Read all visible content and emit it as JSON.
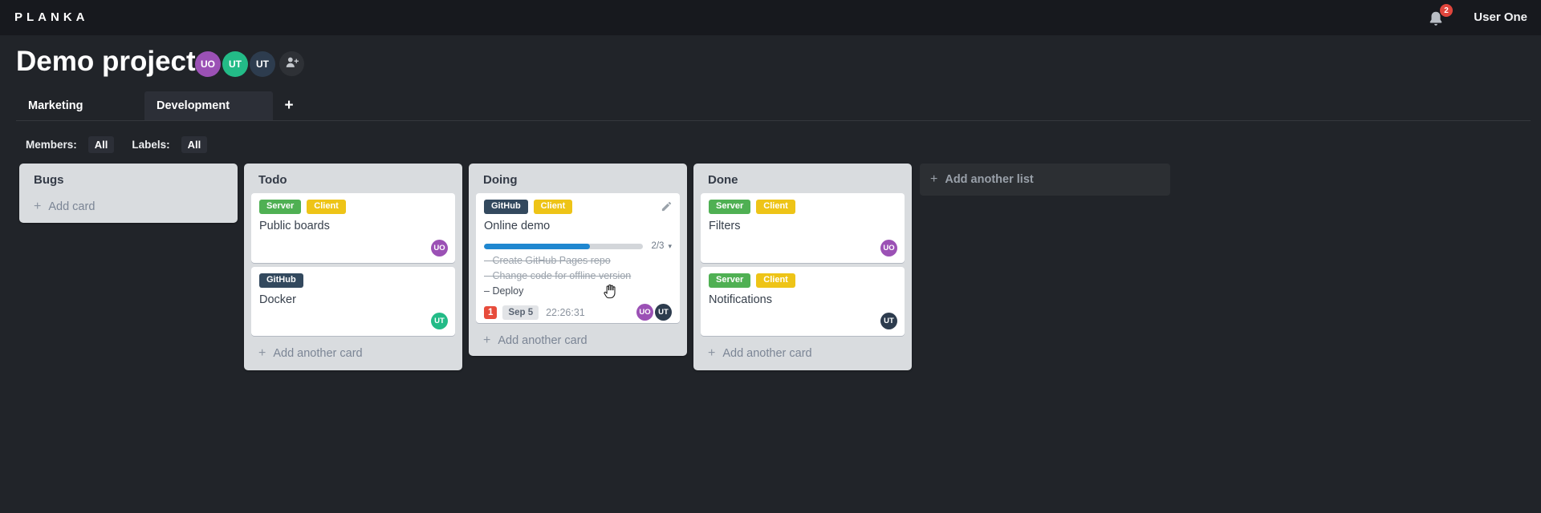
{
  "topbar": {
    "logo": "PLANKA",
    "notification_count": "2",
    "user_name": "User One"
  },
  "project": {
    "title": "Demo project",
    "members": [
      {
        "initials": "UO",
        "color": "#9b51b5"
      },
      {
        "initials": "UT",
        "color": "#23bb87"
      },
      {
        "initials": "UT",
        "color": "#2d3c4e"
      }
    ]
  },
  "tabs": {
    "items": [
      {
        "label": "Marketing"
      },
      {
        "label": "Development"
      }
    ]
  },
  "filters": {
    "members_label": "Members:",
    "members_value": "All",
    "labels_label": "Labels:",
    "labels_value": "All"
  },
  "icons": {
    "plus": "+",
    "chevron_down": "▾"
  },
  "board": {
    "add_list_label": "Add another list",
    "lists": [
      {
        "name": "Bugs",
        "add_label": "Add card",
        "cards": []
      },
      {
        "name": "Todo",
        "add_label": "Add another card",
        "cards": [
          {
            "title": "Public boards",
            "labels": [
              {
                "text": "Server",
                "color": "#4fb053"
              },
              {
                "text": "Client",
                "color": "#eec417"
              }
            ],
            "members": [
              {
                "initials": "UO",
                "color": "#9b51b5"
              }
            ]
          },
          {
            "title": "Docker",
            "labels": [
              {
                "text": "GitHub",
                "color": "#33495e"
              }
            ],
            "members": [
              {
                "initials": "UT",
                "color": "#23bb87"
              }
            ]
          }
        ]
      },
      {
        "name": "Doing",
        "add_label": "Add another card",
        "cards": [
          {
            "title": "Online demo",
            "labels": [
              {
                "text": "GitHub",
                "color": "#33495e"
              },
              {
                "text": "Client",
                "color": "#eec417"
              }
            ],
            "progress": {
              "fraction": "2/3",
              "percent": "66.7%",
              "color": "#1f87d0"
            },
            "tasks": [
              {
                "text": "Create GitHub Pages repo",
                "done": true
              },
              {
                "text": "Change code for offline version",
                "done": true
              },
              {
                "text": "Deploy",
                "done": false
              }
            ],
            "badges": {
              "notification": "1",
              "due_date": "Sep 5",
              "timer": "22:26:31"
            },
            "members": [
              {
                "initials": "UO",
                "color": "#9b51b5"
              },
              {
                "initials": "UT",
                "color": "#2d3c4e"
              }
            ]
          }
        ]
      },
      {
        "name": "Done",
        "add_label": "Add another card",
        "cards": [
          {
            "title": "Filters",
            "labels": [
              {
                "text": "Server",
                "color": "#4fb053"
              },
              {
                "text": "Client",
                "color": "#eec417"
              }
            ],
            "members": [
              {
                "initials": "UO",
                "color": "#9b51b5"
              }
            ]
          },
          {
            "title": "Notifications",
            "labels": [
              {
                "text": "Server",
                "color": "#4fb053"
              },
              {
                "text": "Client",
                "color": "#eec417"
              }
            ],
            "members": [
              {
                "initials": "UT",
                "color": "#2d3c4e"
              }
            ]
          }
        ]
      }
    ]
  }
}
